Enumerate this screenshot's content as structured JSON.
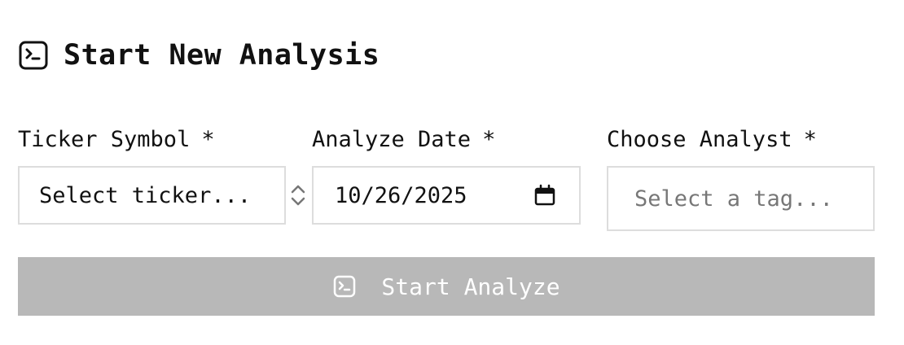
{
  "header": {
    "title": "Start New Analysis",
    "icon": "terminal-square-icon"
  },
  "fields": {
    "ticker": {
      "label": "Ticker Symbol",
      "required_marker": "*",
      "placeholder": "Select ticker...",
      "spinner_icon": "chevron-up-down-icon"
    },
    "date": {
      "label": "Analyze Date",
      "required_marker": "*",
      "value": "10/26/2025",
      "icon": "calendar-icon"
    },
    "analyst": {
      "label": "Choose Analyst",
      "required_marker": "*",
      "placeholder": "Select a tag..."
    }
  },
  "submit": {
    "label": "Start Analyze",
    "icon": "terminal-square-icon",
    "disabled": true,
    "background_color": "#b8b8b8",
    "text_color": "#ffffff"
  }
}
